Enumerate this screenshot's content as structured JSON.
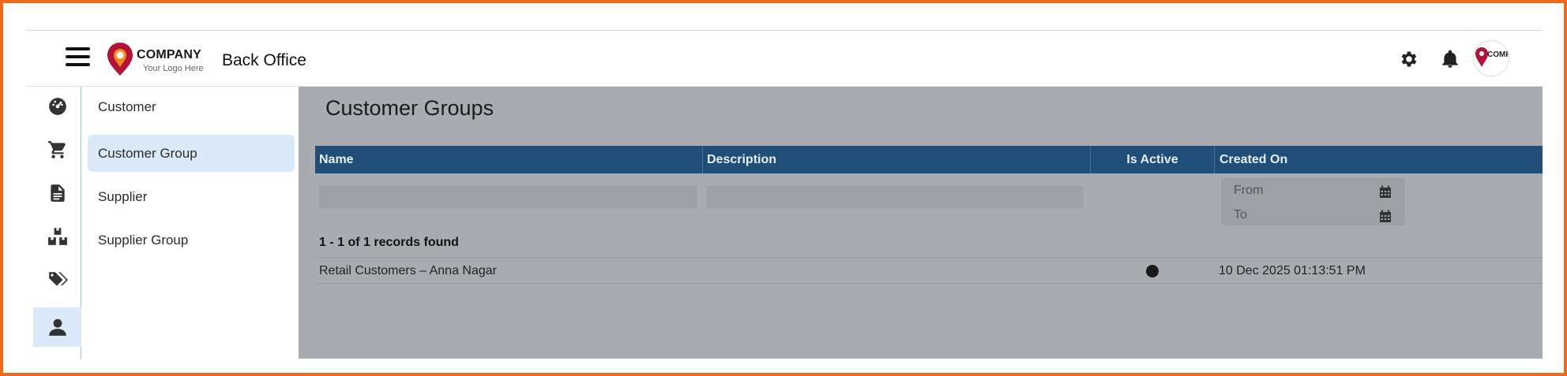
{
  "header": {
    "logo": {
      "name": "COMPANY",
      "tagline": "Your Logo Here"
    },
    "app_title": "Back Office",
    "icons": [
      "menu-icon",
      "gear-icon",
      "bell-icon"
    ],
    "avatar_text": "COMPANY"
  },
  "rail": {
    "items": [
      {
        "icon": "dashboard-icon",
        "active": false
      },
      {
        "icon": "cart-icon",
        "active": false
      },
      {
        "icon": "document-icon",
        "active": false
      },
      {
        "icon": "boxes-icon",
        "active": false
      },
      {
        "icon": "tags-icon",
        "active": false
      },
      {
        "icon": "user-icon",
        "active": true
      }
    ]
  },
  "submenu": {
    "items": [
      {
        "label": "Customer",
        "active": false
      },
      {
        "label": "Customer Group",
        "active": true
      },
      {
        "label": "Supplier",
        "active": false
      },
      {
        "label": "Supplier Group",
        "active": false
      }
    ]
  },
  "main": {
    "title": "Customer Groups",
    "columns": [
      "Name",
      "Description",
      "Is Active",
      "Created On"
    ],
    "filters": {
      "name": "",
      "description": "",
      "from_placeholder": "From",
      "to_placeholder": "To"
    },
    "records_text": "1 - 1 of 1 records found",
    "rows": [
      {
        "name": "Retail Customers – Anna Nagar",
        "description": "",
        "is_active": true,
        "created_on": "10 Dec 2025 01:13:51 PM"
      }
    ]
  },
  "colors": {
    "frame": "#ef6a1f",
    "grid_header": "#1f4e79",
    "active_item": "#dbeafa",
    "content_overlay": "#a8acb0",
    "logo_red": "#b5123a",
    "logo_orange": "#f28b20"
  }
}
